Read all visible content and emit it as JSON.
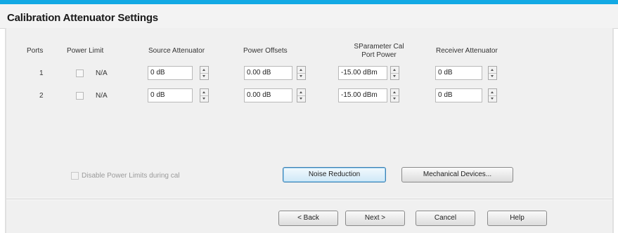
{
  "window": {
    "title": "Calibration Attenuator Settings"
  },
  "table": {
    "headers": {
      "ports": "Ports",
      "power_limit": "Power Limit",
      "source_attenuator": "Source Attenuator",
      "power_offsets": "Power Offsets",
      "sparam_line1": "SParameter Cal",
      "sparam_line2": "Port Power",
      "receiver_attenuator": "Receiver Attenuator"
    },
    "rows": [
      {
        "port": "1",
        "power_limit": "N/A",
        "source_attenuator": "0 dB",
        "power_offset": "0.00 dB",
        "port_power": "-15.00 dBm",
        "receiver_attenuator": "0 dB"
      },
      {
        "port": "2",
        "power_limit": "N/A",
        "source_attenuator": "0 dB",
        "power_offset": "0.00 dB",
        "port_power": "-15.00 dBm",
        "receiver_attenuator": "0 dB"
      }
    ]
  },
  "options": {
    "disable_power_limits": "Disable Power Limits during cal"
  },
  "buttons": {
    "noise_reduction": "Noise Reduction",
    "mechanical_devices": "Mechanical Devices...",
    "back": "< Back",
    "next": "Next >",
    "cancel": "Cancel",
    "help": "Help"
  },
  "colors": {
    "accent_bar": "#12a9e4",
    "dialog_bg": "#f0f0f0"
  }
}
